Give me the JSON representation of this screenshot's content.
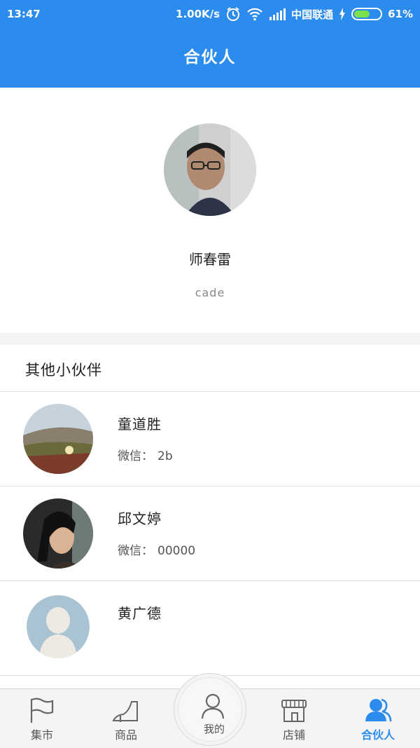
{
  "status_bar": {
    "time": "13:47",
    "net_speed": "1.00K/s",
    "carrier": "中国联通",
    "battery": "61%",
    "battery_level": 0.61
  },
  "header": {
    "title": "合伙人"
  },
  "profile": {
    "name": "师春雷",
    "subtitle": "cade"
  },
  "partners": {
    "section_title": "其他小伙伴",
    "wechat_label": "微信：",
    "items": [
      {
        "name": "童道胜",
        "wechat": "2b"
      },
      {
        "name": "邱文婷",
        "wechat": "00000"
      },
      {
        "name": "黄广德",
        "wechat": ""
      }
    ]
  },
  "tabbar": {
    "tabs": [
      {
        "label": "集市",
        "icon": "flag-icon"
      },
      {
        "label": "商品",
        "icon": "high-heel-icon"
      },
      {
        "label": "我的",
        "icon": "person-icon"
      },
      {
        "label": "店铺",
        "icon": "store-icon"
      },
      {
        "label": "合伙人",
        "icon": "partners-icon",
        "active": true
      }
    ],
    "active_color": "#2b8ced"
  },
  "colors": {
    "accent": "#2b8ced",
    "battery_fill": "#7be04a"
  }
}
